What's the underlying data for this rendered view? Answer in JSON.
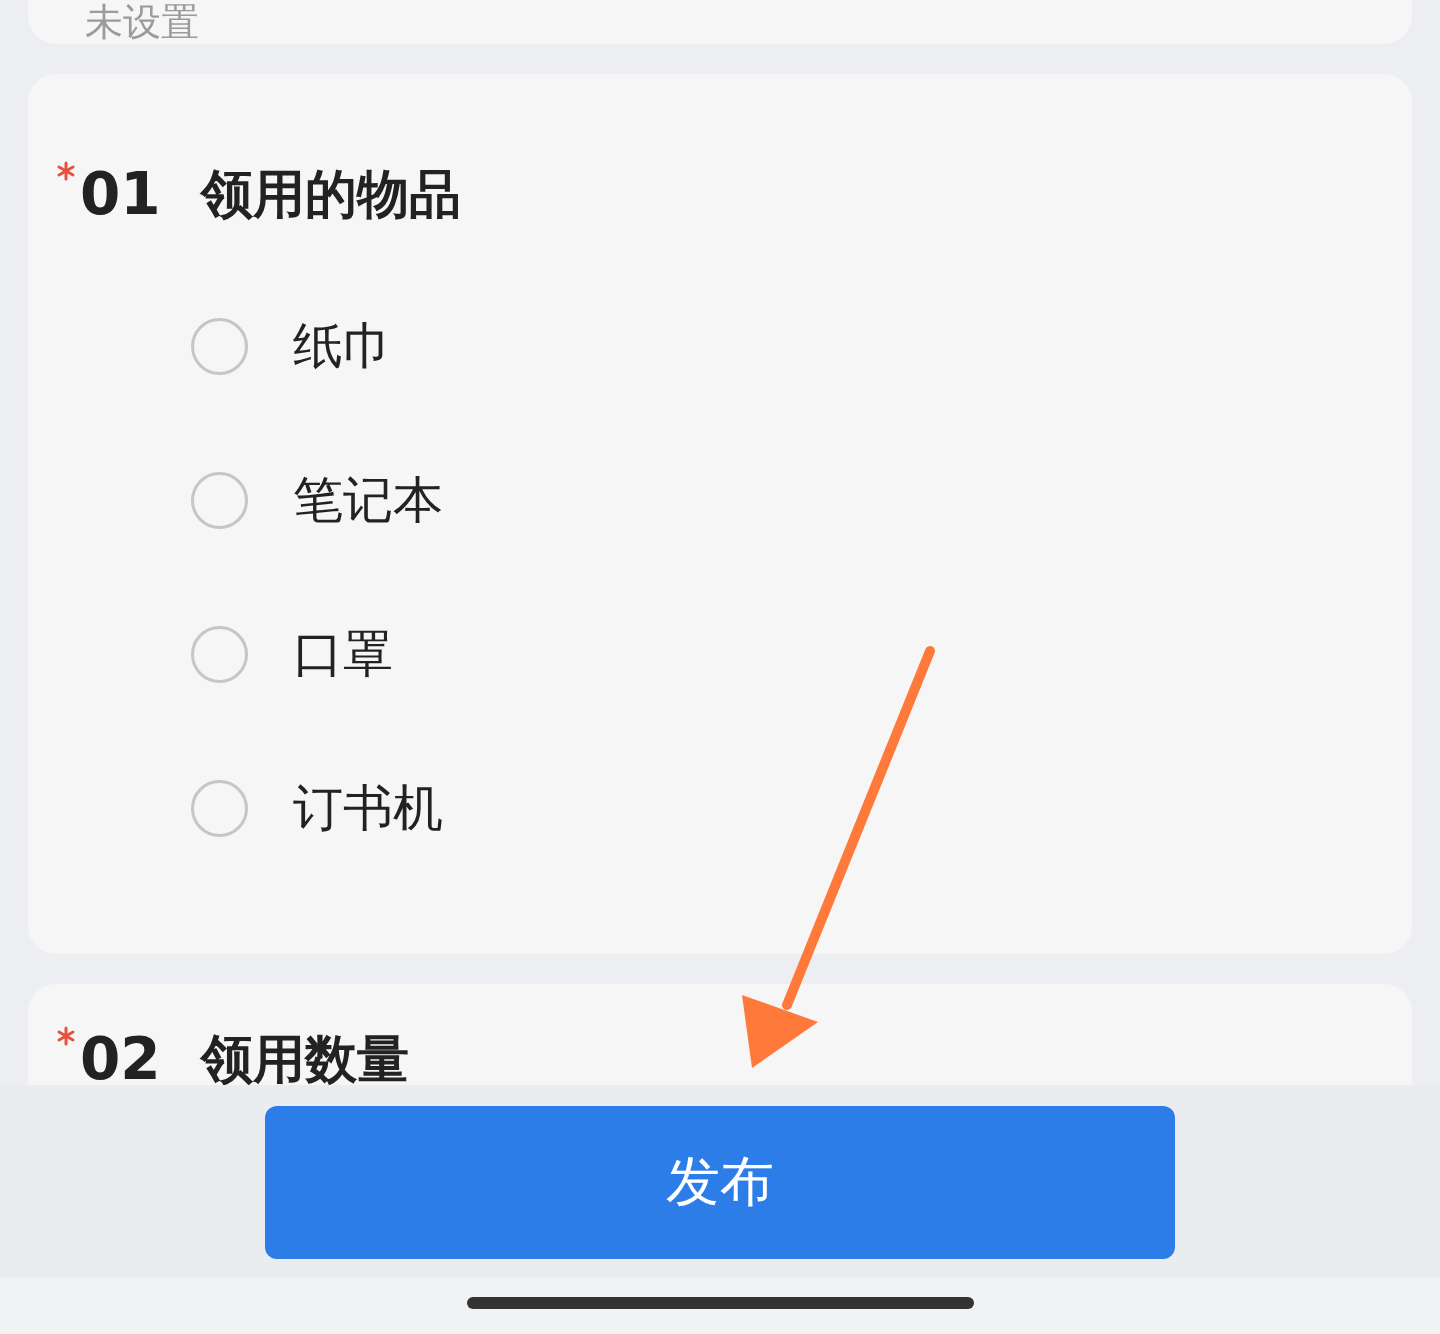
{
  "top_card": {
    "value": "未设置"
  },
  "questions": [
    {
      "required": true,
      "number": "01",
      "title": "领用的物品",
      "options": [
        {
          "label": "纸巾",
          "selected": false
        },
        {
          "label": "笔记本",
          "selected": false
        },
        {
          "label": "口罩",
          "selected": false
        },
        {
          "label": "订书机",
          "selected": false
        }
      ]
    },
    {
      "required": true,
      "number": "02",
      "title": "领用数量"
    }
  ],
  "publish_button": {
    "label": "发布"
  }
}
